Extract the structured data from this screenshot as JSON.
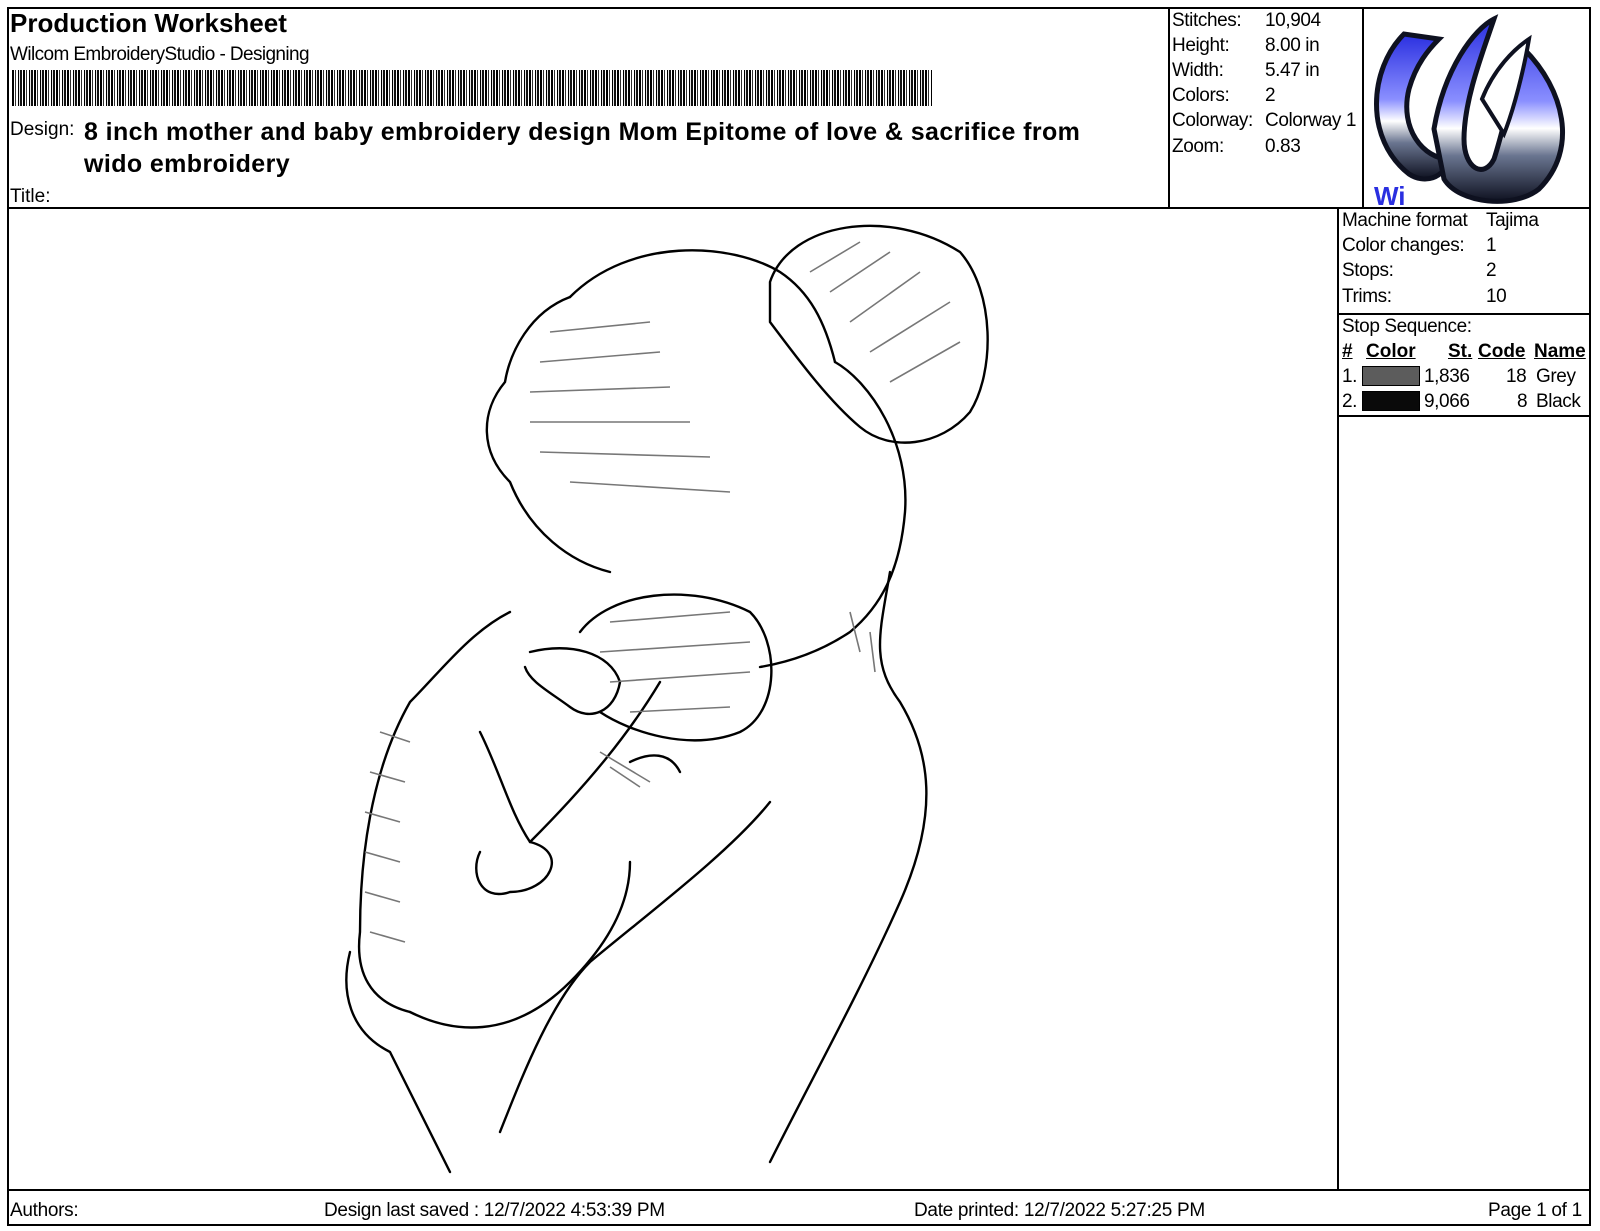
{
  "header": {
    "title": "Production Worksheet",
    "subtitle": "Wilcom EmbroideryStudio - Designing",
    "design_label": "Design:",
    "design_value": "8 inch mother and baby embroidery design Mom Epitome of love & sacrifice from wido embroidery",
    "title_label": "Title:"
  },
  "stats": {
    "stitches_label": "Stitches:",
    "stitches_value": "10,904",
    "height_label": "Height:",
    "height_value": "8.00 in",
    "width_label": "Width:",
    "width_value": "5.47 in",
    "colors_label": "Colors:",
    "colors_value": "2",
    "colorway_label": "Colorway:",
    "colorway_value": "Colorway 1",
    "zoom_label": "Zoom:",
    "zoom_value": "0.83"
  },
  "logo": {
    "text": "Wi",
    "colors": {
      "blue": "#2a2fe0",
      "dark": "#0e1120"
    }
  },
  "machine": {
    "format_label": "Machine format",
    "format_value": "Tajima",
    "color_changes_label": "Color changes:",
    "color_changes_value": "1",
    "stops_label": "Stops:",
    "stops_value": "2",
    "trims_label": "Trims:",
    "trims_value": "10"
  },
  "stop_sequence": {
    "label": "Stop Sequence:",
    "headers": {
      "num": "#",
      "color": "Color",
      "st": "St.",
      "code": "Code",
      "name": "Name"
    },
    "rows": [
      {
        "num": "1.",
        "swatch": "#5c5c5c",
        "stitches": "1,836",
        "code": "18",
        "name": "Grey"
      },
      {
        "num": "2.",
        "swatch": "#0a0a0a",
        "stitches": "9,066",
        "code": "8",
        "name": "Black"
      }
    ]
  },
  "footer": {
    "authors_label": "Authors:",
    "saved": "Design last saved : 12/7/2022 4:53:39 PM",
    "printed": "Date printed: 12/7/2022 5:27:25 PM",
    "page": "Page 1 of 1"
  }
}
